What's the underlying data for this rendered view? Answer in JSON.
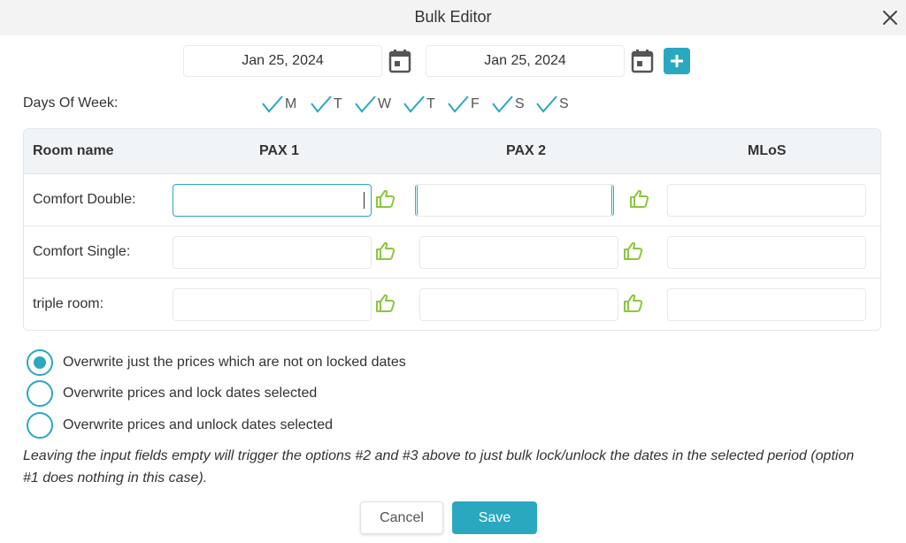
{
  "dialog": {
    "title": "Bulk Editor"
  },
  "dates": {
    "start": "Jan 25, 2024",
    "end": "Jan 25, 2024"
  },
  "days_of_week": {
    "label": "Days Of Week:",
    "days": [
      {
        "letter": "M",
        "checked": true
      },
      {
        "letter": "T",
        "checked": true
      },
      {
        "letter": "W",
        "checked": true
      },
      {
        "letter": "T",
        "checked": true
      },
      {
        "letter": "F",
        "checked": true
      },
      {
        "letter": "S",
        "checked": true
      },
      {
        "letter": "S",
        "checked": true
      }
    ]
  },
  "table": {
    "headers": {
      "room": "Room name",
      "pax1": "PAX 1",
      "pax2": "PAX 2",
      "mlos": "MLoS"
    },
    "rows": [
      {
        "name": "Comfort Double:",
        "pax1": "",
        "pax2": "",
        "mlos": ""
      },
      {
        "name": "Comfort Single:",
        "pax1": "",
        "pax2": "",
        "mlos": ""
      },
      {
        "name": "triple room:",
        "pax1": "",
        "pax2": "",
        "mlos": ""
      }
    ]
  },
  "options": [
    {
      "label": "Overwrite just the prices which are not on locked dates",
      "checked": true
    },
    {
      "label": "Overwrite prices and lock dates selected",
      "checked": false
    },
    {
      "label": "Overwrite prices and unlock dates selected",
      "checked": false
    }
  ],
  "note": "Leaving the input fields empty will trigger the options #2 and #3 above to just bulk lock/unlock the dates in the selected period (option #1 does nothing in this case).",
  "buttons": {
    "cancel": "Cancel",
    "save": "Save"
  },
  "colors": {
    "accent": "#2aa8c0",
    "thumb": "#8dc63f"
  },
  "icons": {
    "close": "close-icon",
    "calendar": "calendar-icon",
    "add": "plus-icon",
    "check": "check-icon",
    "thumbs_up": "thumbs-up-icon"
  }
}
